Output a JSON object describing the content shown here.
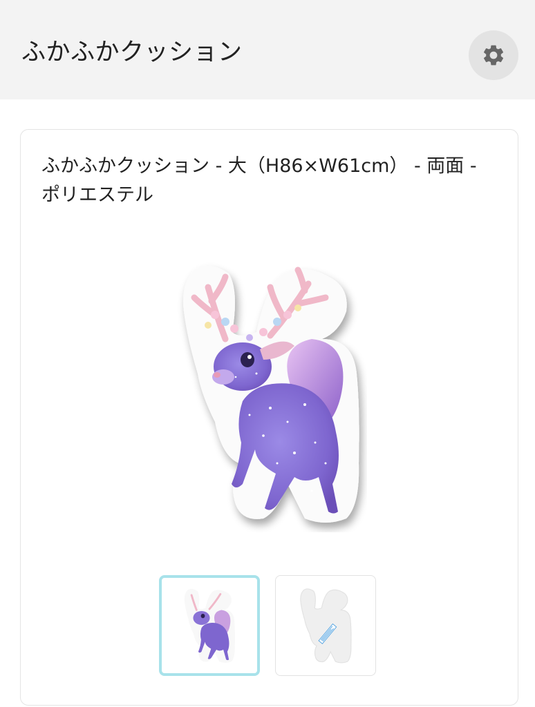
{
  "header": {
    "title": "ふかふかクッション",
    "settings_icon": "gear-icon"
  },
  "product": {
    "title": "ふかふかクッション - 大（H86×W61cm） - 両面 - ポリエステル",
    "main_image": "purple-starry-deer-cushion",
    "thumbnails": [
      {
        "image": "deer-cushion-front",
        "selected": true
      },
      {
        "image": "cushion-back-tag",
        "selected": false
      }
    ]
  },
  "colors": {
    "header_bg": "#f3f3f3",
    "selected_thumb_border": "#a8e2ea",
    "deer_body": "#8a73d6"
  }
}
